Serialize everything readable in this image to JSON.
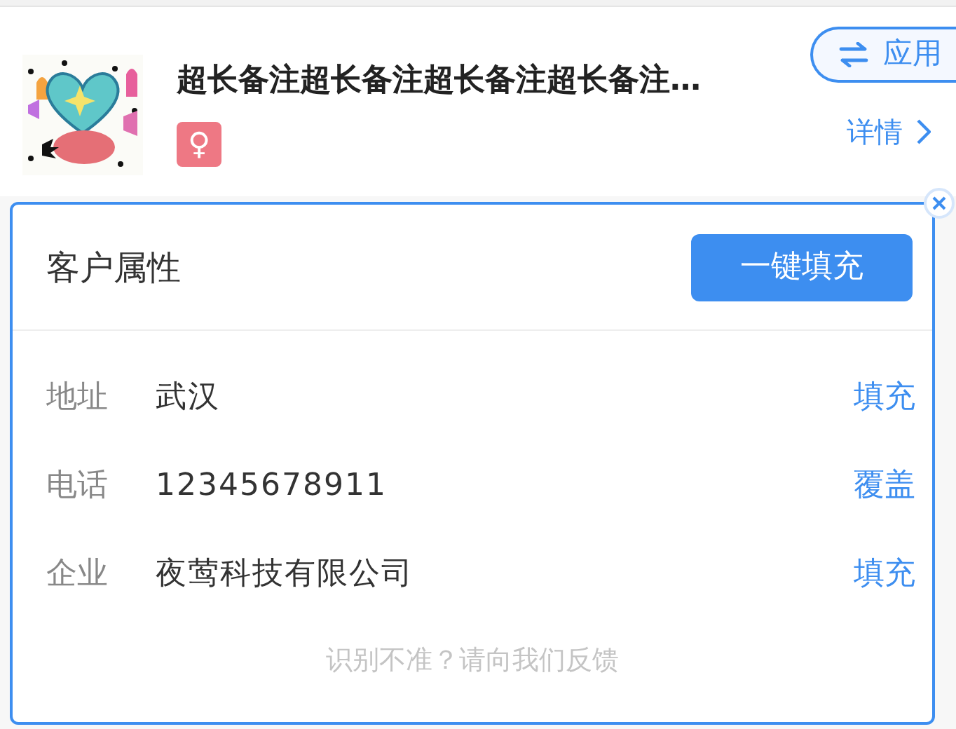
{
  "contact": {
    "name": "超长备注超长备注超长备注超长备注…",
    "gender_symbol": "♀",
    "apply_button": "应用",
    "details_link": "详情"
  },
  "card": {
    "title": "客户属性",
    "fill_all_button": "一键填充",
    "fields": [
      {
        "label": "地址",
        "value": "武汉",
        "action": "填充"
      },
      {
        "label": "电话",
        "value": "12345678911",
        "action": "覆盖"
      },
      {
        "label": "企业",
        "value": "夜莺科技有限公司",
        "action": "填充"
      }
    ],
    "feedback": "识别不准？请向我们反馈"
  }
}
